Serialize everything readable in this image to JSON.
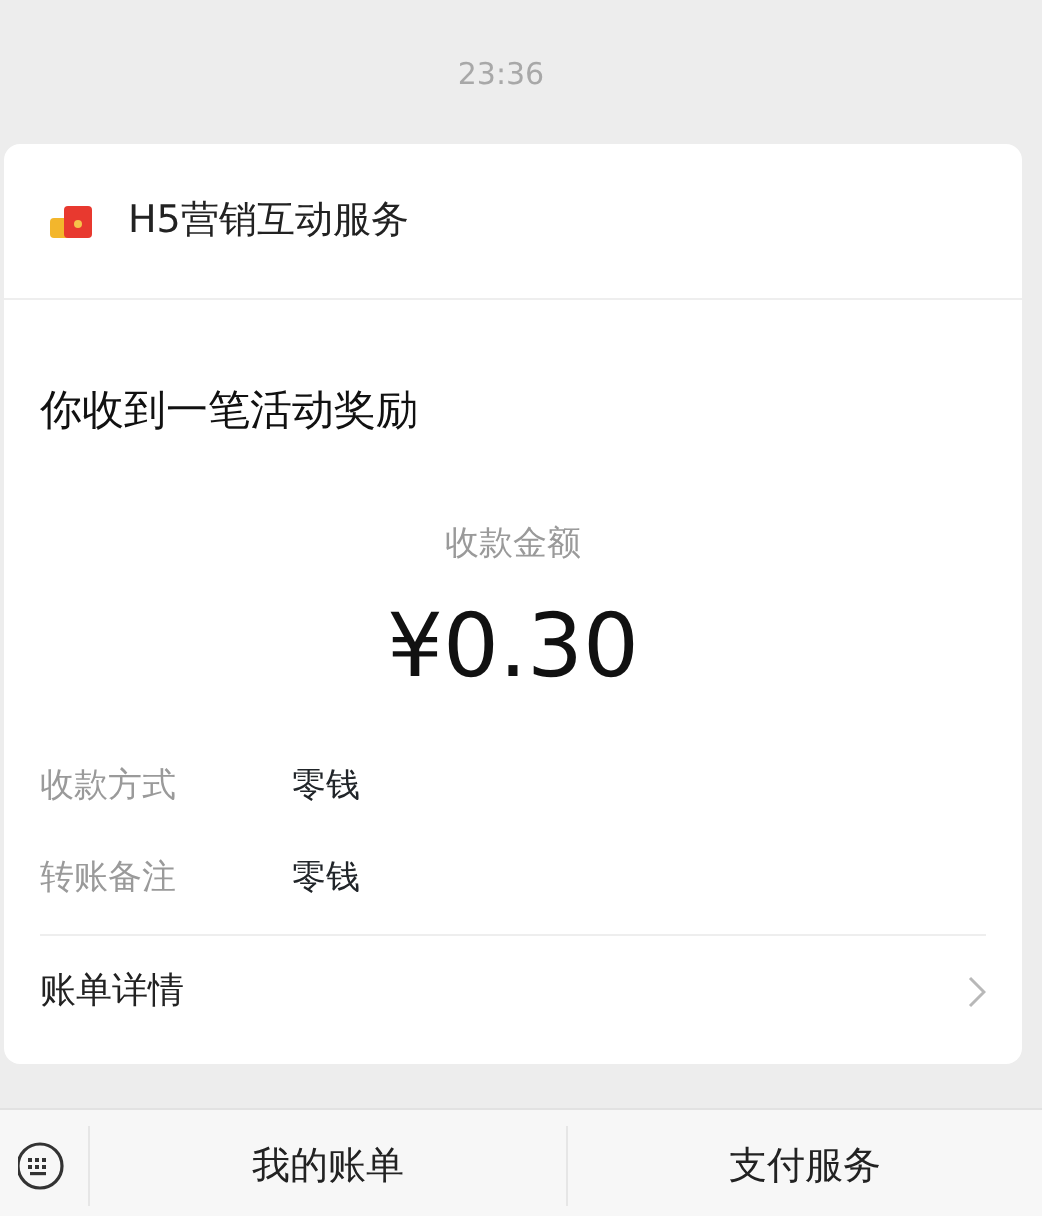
{
  "time": "23:36",
  "card": {
    "service_name": "H5营销互动服务",
    "title": "你收到一笔活动奖励",
    "amount_label": "收款金额",
    "amount": "¥0.30",
    "details": [
      {
        "label": "收款方式",
        "value": "零钱"
      },
      {
        "label": "转账备注",
        "value": "零钱"
      }
    ],
    "link": "账单详情"
  },
  "bottom_menu": [
    "我的账单",
    "支付服务"
  ]
}
